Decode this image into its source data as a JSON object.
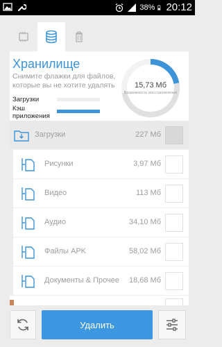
{
  "status_bar": {
    "battery_percent": "38%",
    "time": "20:12",
    "icons": [
      "image-icon",
      "wrench-icon",
      "alarm-icon",
      "signal-icon",
      "battery-icon"
    ]
  },
  "tabs": [
    {
      "name": "cpu",
      "icon": "cpu-icon",
      "active": false
    },
    {
      "name": "storage",
      "icon": "database-icon",
      "active": true
    },
    {
      "name": "trash",
      "icon": "trash-icon",
      "active": false
    }
  ],
  "storage": {
    "title": "Хранилище",
    "subtitle": "Снимите флажки для файлов, которые вы не хотите удалять",
    "legend": [
      {
        "label": "Загрузки",
        "color": "#eeeeee"
      },
      {
        "label": "Кэш приложения",
        "color": "#3c93d8"
      }
    ],
    "donut": {
      "value": "15,73 Мб",
      "caption": "Возможность восстановления",
      "fraction_filled": 0.72,
      "fill_color": "#e0e0e0",
      "accent_fraction": 0.22,
      "accent_color": "#3c93d8"
    }
  },
  "items": [
    {
      "label": "Загрузки",
      "size": "227 Мб",
      "level": "parent"
    },
    {
      "label": "Рисунки",
      "size": "3,97 Мб",
      "level": "child"
    },
    {
      "label": "Видео",
      "size": "113 Мб",
      "level": "child"
    },
    {
      "label": "Аудио",
      "size": "34,10 Мб",
      "level": "child"
    },
    {
      "label": "Файлы APK",
      "size": "58,02 Мб",
      "level": "child"
    },
    {
      "label": "Документы & Прочее",
      "size": "18,68 Мб",
      "level": "child"
    }
  ],
  "actions": {
    "delete_label": "Удалить",
    "refresh_icon": "refresh-icon",
    "settings_icon": "sliders-icon"
  },
  "colors": {
    "accent": "#3c97e0",
    "background": "#ececec"
  }
}
